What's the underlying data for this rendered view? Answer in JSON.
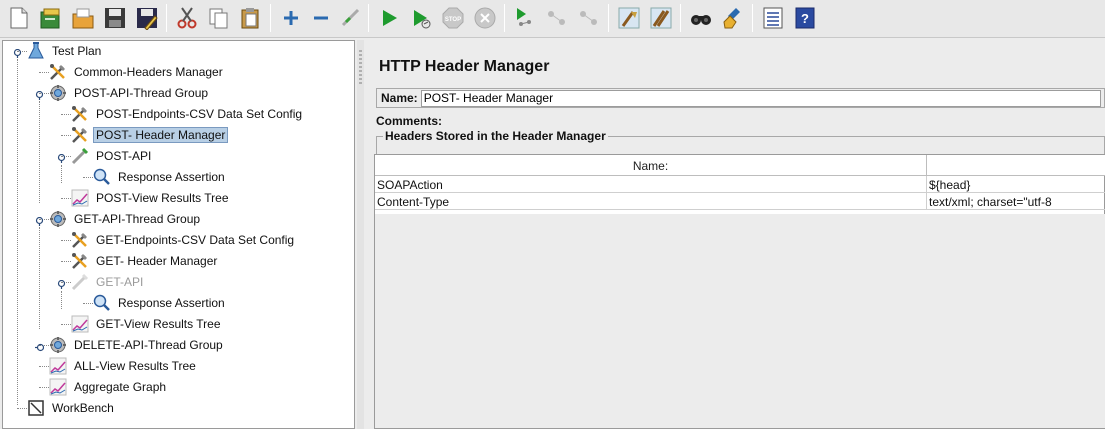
{
  "toolbar": {
    "buttons": [
      {
        "name": "new-icon"
      },
      {
        "name": "templates-icon"
      },
      {
        "name": "open-icon"
      },
      {
        "name": "save-icon"
      },
      {
        "name": "save-as-icon"
      },
      {
        "name": "cut-icon"
      },
      {
        "name": "copy-icon"
      },
      {
        "name": "paste-icon"
      },
      {
        "name": "expand-icon"
      },
      {
        "name": "collapse-icon"
      },
      {
        "name": "toggle-icon"
      },
      {
        "name": "start-icon"
      },
      {
        "name": "start-no-pauses-icon"
      },
      {
        "name": "stop-icon"
      },
      {
        "name": "shutdown-icon"
      },
      {
        "name": "remote-start-icon"
      },
      {
        "name": "remote-stop-icon"
      },
      {
        "name": "remote-shutdown-icon"
      },
      {
        "name": "clear-icon"
      },
      {
        "name": "clear-all-icon"
      },
      {
        "name": "search-icon"
      },
      {
        "name": "reset-search-icon"
      },
      {
        "name": "function-helper-icon"
      },
      {
        "name": "help-icon"
      }
    ]
  },
  "tree": {
    "nodes": [
      {
        "label": "Test Plan",
        "icon": "test-plan-icon"
      },
      {
        "label": "Common-Headers Manager",
        "icon": "config-icon"
      },
      {
        "label": "POST-API-Thread Group",
        "icon": "thread-group-icon"
      },
      {
        "label": "POST-Endpoints-CSV Data Set Config",
        "icon": "config-icon"
      },
      {
        "label": "POST- Header Manager",
        "icon": "config-icon"
      },
      {
        "label": "POST-API",
        "icon": "sampler-icon"
      },
      {
        "label": "Response Assertion",
        "icon": "assertion-icon"
      },
      {
        "label": "POST-View Results Tree",
        "icon": "listener-icon"
      },
      {
        "label": "GET-API-Thread Group",
        "icon": "thread-group-icon"
      },
      {
        "label": "GET-Endpoints-CSV Data Set Config",
        "icon": "config-icon"
      },
      {
        "label": "GET- Header Manager",
        "icon": "config-icon"
      },
      {
        "label": "GET-API",
        "icon": "sampler-icon"
      },
      {
        "label": "Response Assertion",
        "icon": "assertion-icon"
      },
      {
        "label": "GET-View Results Tree",
        "icon": "listener-icon"
      },
      {
        "label": "DELETE-API-Thread Group",
        "icon": "thread-group-icon"
      },
      {
        "label": "ALL-View Results Tree",
        "icon": "listener-icon"
      },
      {
        "label": "Aggregate Graph",
        "icon": "listener-icon"
      },
      {
        "label": "WorkBench",
        "icon": "workbench-icon"
      }
    ]
  },
  "panel": {
    "title": "HTTP Header Manager",
    "name_label": "Name:",
    "name_value": "POST- Header Manager",
    "comments_label": "Comments:",
    "group_label": "Headers Stored in the Header Manager",
    "columns": [
      "Name:",
      ""
    ],
    "rows": [
      [
        "SOAPAction",
        "${head}"
      ],
      [
        "Content-Type",
        "text/xml; charset=\"utf-8"
      ]
    ]
  }
}
